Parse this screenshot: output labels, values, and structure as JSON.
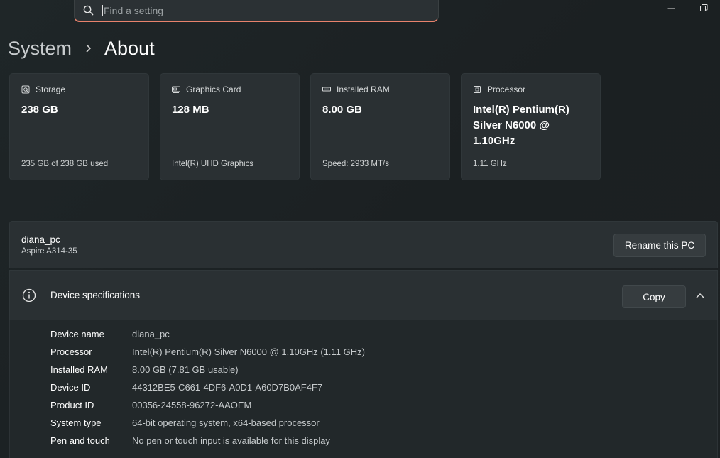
{
  "search": {
    "placeholder": "Find a setting"
  },
  "breadcrumb": {
    "parent": "System",
    "current": "About"
  },
  "cards": [
    {
      "title": "Storage",
      "value": "238 GB",
      "sub": "235 GB of 238 GB used",
      "icon": "storage-icon"
    },
    {
      "title": "Graphics Card",
      "value": "128 MB",
      "sub": "Intel(R) UHD Graphics",
      "icon": "graphics-card-icon"
    },
    {
      "title": "Installed RAM",
      "value": "8.00 GB",
      "sub": "Speed: 2933 MT/s",
      "icon": "ram-icon"
    },
    {
      "title": "Processor",
      "value": "Intel(R) Pentium(R) Silver N6000 @ 1.10GHz",
      "sub": "1.11 GHz",
      "icon": "processor-icon"
    }
  ],
  "pc": {
    "name": "diana_pc",
    "model": "Aspire A314-35",
    "rename_label": "Rename this PC"
  },
  "specs": {
    "title": "Device specifications",
    "copy_label": "Copy",
    "rows": [
      {
        "label": "Device name",
        "value": "diana_pc"
      },
      {
        "label": "Processor",
        "value": "Intel(R) Pentium(R) Silver N6000 @ 1.10GHz (1.11 GHz)"
      },
      {
        "label": "Installed RAM",
        "value": "8.00 GB (7.81 GB usable)"
      },
      {
        "label": "Device ID",
        "value": "44312BE5-C661-4DF6-A0D1-A60D7B0AF4F7"
      },
      {
        "label": "Product ID",
        "value": "00356-24558-96272-AAOEM"
      },
      {
        "label": "System type",
        "value": "64-bit operating system, x64-based processor"
      },
      {
        "label": "Pen and touch",
        "value": "No pen or touch input is available for this display"
      }
    ]
  },
  "colors": {
    "accent_underline": "#e8826c",
    "card_bg": "#2a3033",
    "page_bg": "#1e2426"
  }
}
